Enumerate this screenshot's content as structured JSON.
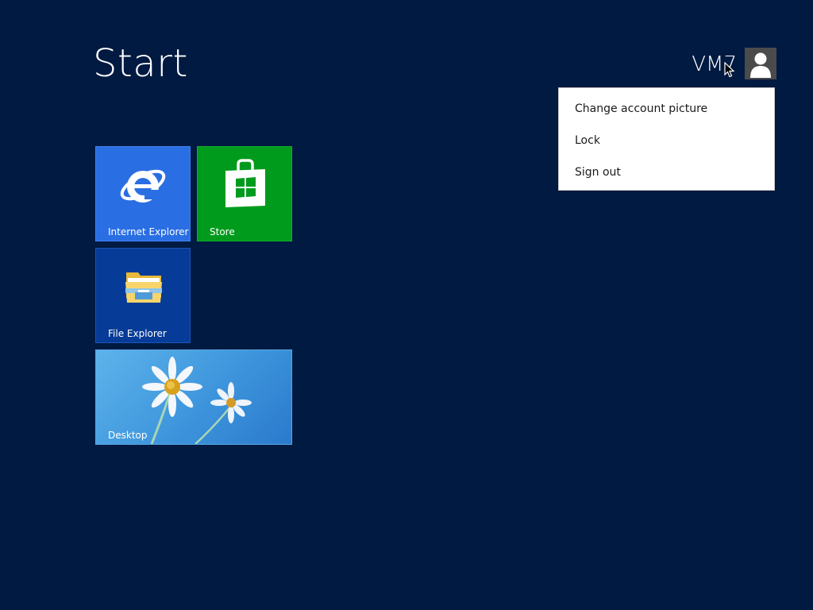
{
  "screen": {
    "title": "Start",
    "background_color": "#011a41"
  },
  "user": {
    "name": "VM7"
  },
  "account_menu": {
    "items": [
      {
        "label": "Change account picture"
      },
      {
        "label": "Lock"
      },
      {
        "label": "Sign out"
      }
    ]
  },
  "tiles": [
    {
      "label": "Internet Explorer",
      "color": "#2a6ee3",
      "icon": "internet-explorer-icon"
    },
    {
      "label": "Store",
      "color": "#009b1c",
      "icon": "store-icon"
    },
    {
      "label": "File Explorer",
      "color": "#063b97",
      "icon": "file-explorer-icon"
    },
    {
      "label": "Desktop",
      "color": "#3e95dc",
      "icon": "desktop-wallpaper-daisies"
    }
  ]
}
